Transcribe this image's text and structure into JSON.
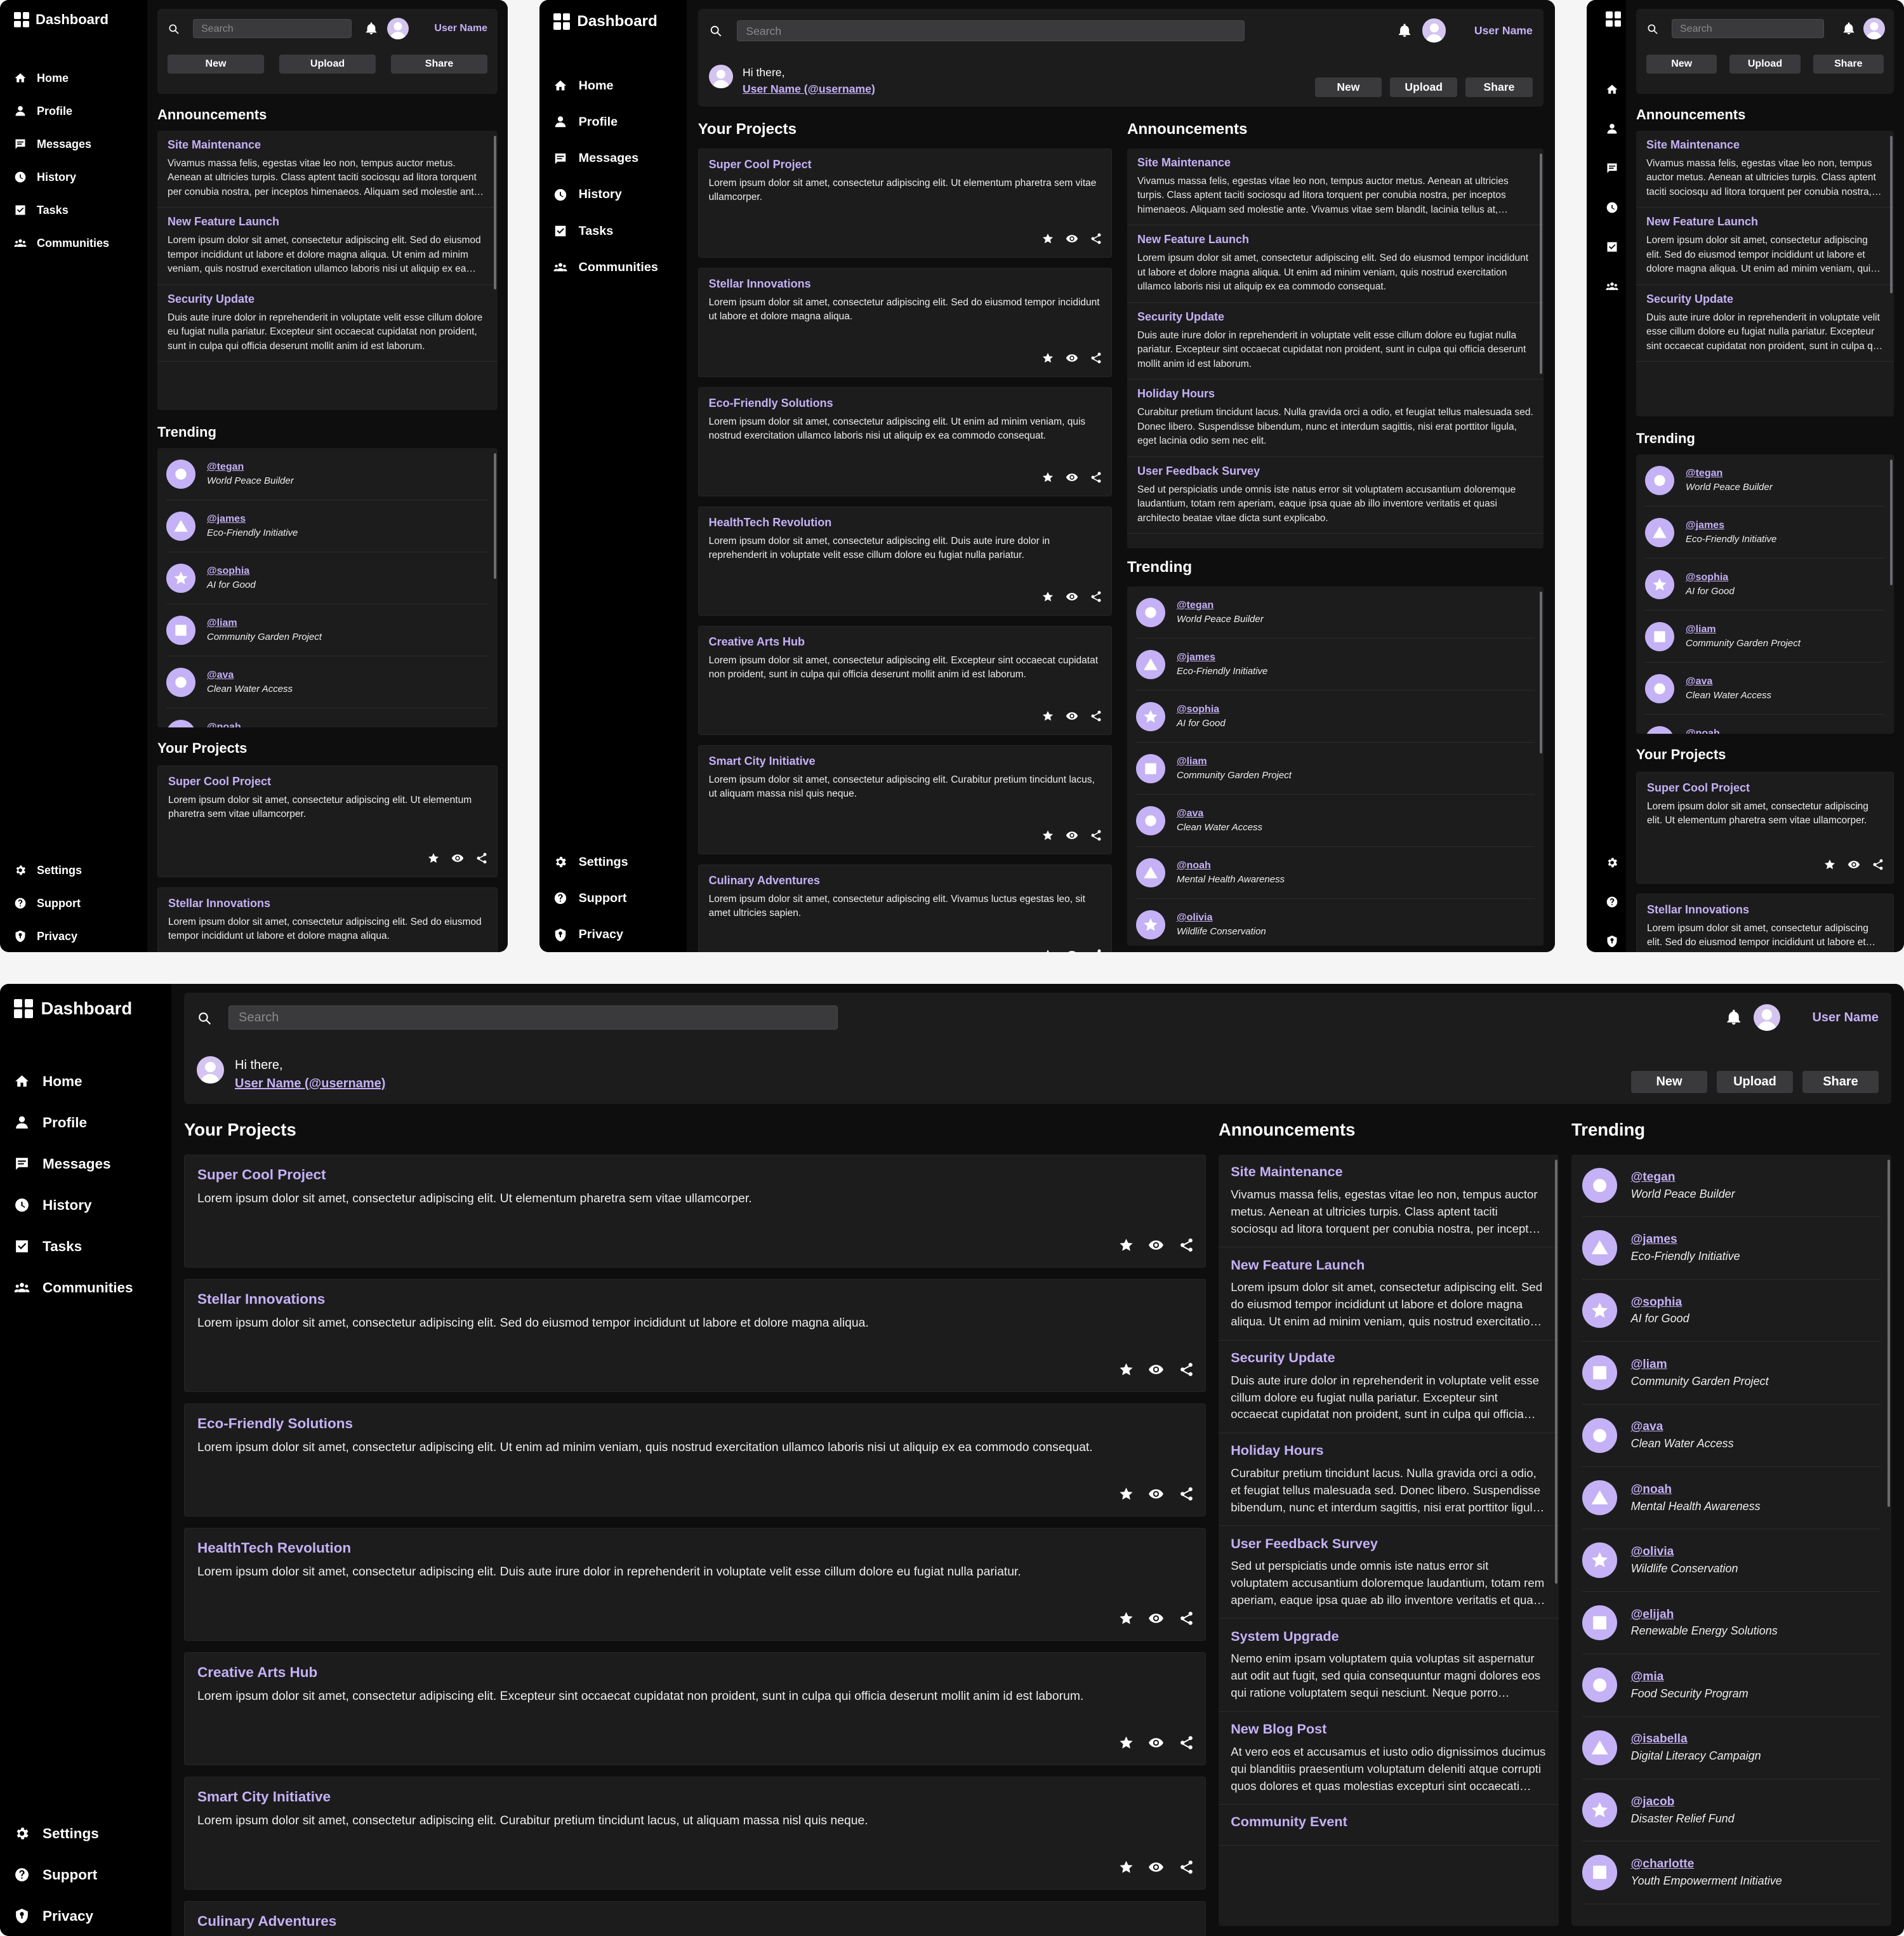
{
  "app": {
    "title": "Dashboard",
    "accent": "#c5b1f5",
    "background": "#000000",
    "surface": "#1c1c1d"
  },
  "nav": [
    {
      "label": "Home",
      "icon": "home-icon"
    },
    {
      "label": "Profile",
      "icon": "user-icon"
    },
    {
      "label": "Messages",
      "icon": "message-icon"
    },
    {
      "label": "History",
      "icon": "clock-icon"
    },
    {
      "label": "Tasks",
      "icon": "checkbox-icon"
    },
    {
      "label": "Communities",
      "icon": "people-icon"
    }
  ],
  "bottom_nav": [
    {
      "label": "Settings",
      "icon": "gear-icon"
    },
    {
      "label": "Support",
      "icon": "help-icon"
    },
    {
      "label": "Privacy",
      "icon": "privacy-icon"
    }
  ],
  "header": {
    "search_placeholder": "Search",
    "user_name": "User Name",
    "greeting": "Hi there,",
    "user_link": "User Name (@username)",
    "buttons": [
      "New",
      "Upload",
      "Share"
    ]
  },
  "sections": {
    "announcements": "Announcements",
    "trending": "Trending",
    "projects": "Your Projects"
  },
  "announcements": [
    {
      "title": "Site Maintenance",
      "body": "Vivamus massa felis, egestas vitae leo non, tempus auctor metus. Aenean at ultricies turpis. Class aptent taciti sociosqu ad litora torquent per conubia nostra, per inceptos himenaeos. Aliquam sed molestie ante. Vivamus vitae sem blandit, lacinia tellus at, pulvinar est."
    },
    {
      "title": "New Feature Launch",
      "body": "Lorem ipsum dolor sit amet, consectetur adipiscing elit. Sed do eiusmod tempor incididunt ut labore et dolore magna aliqua. Ut enim ad minim veniam, quis nostrud exercitation ullamco laboris nisi ut aliquip ex ea commodo consequat."
    },
    {
      "title": "Security Update",
      "body": "Duis aute irure dolor in reprehenderit in voluptate velit esse cillum dolore eu fugiat nulla pariatur. Excepteur sint occaecat cupidatat non proident, sunt in culpa qui officia deserunt mollit anim id est laborum."
    },
    {
      "title": "Holiday Hours",
      "body": "Curabitur pretium tincidunt lacus. Nulla gravida orci a odio, et feugiat tellus malesuada sed. Donec libero. Suspendisse bibendum, nunc et interdum sagittis, nisi erat porttitor ligula, eget lacinia odio sem nec elit."
    },
    {
      "title": "User Feedback Survey",
      "body": "Sed ut perspiciatis unde omnis iste natus error sit voluptatem accusantium doloremque laudantium, totam rem aperiam, eaque ipsa quae ab illo inventore veritatis et quasi architecto beatae vitae dicta sunt explicabo."
    },
    {
      "title": "System Upgrade",
      "body": "Nemo enim ipsam voluptatem quia voluptas sit aspernatur aut odit aut fugit, sed quia consequuntur magni dolores eos qui ratione voluptatem sequi nesciunt. Neque porro quisquam est."
    },
    {
      "title": "New Blog Post",
      "body": "At vero eos et accusamus et iusto odio dignissimos ducimus qui blanditiis praesentium voluptatum deleniti atque corrupti quos dolores et quas molestias excepturi sint occaecati cupiditate non provident."
    },
    {
      "title": "Community Event",
      "body": ""
    }
  ],
  "trending": [
    {
      "handle": "@tegan",
      "project": "World Peace Builder",
      "shape": "circle"
    },
    {
      "handle": "@james",
      "project": "Eco-Friendly Initiative",
      "shape": "triangle"
    },
    {
      "handle": "@sophia",
      "project": "AI for Good",
      "shape": "star"
    },
    {
      "handle": "@liam",
      "project": "Community Garden Project",
      "shape": "square"
    },
    {
      "handle": "@ava",
      "project": "Clean Water Access",
      "shape": "circle"
    },
    {
      "handle": "@noah",
      "project": "Mental Health Awareness",
      "shape": "triangle"
    },
    {
      "handle": "@olivia",
      "project": "Wildlife Conservation",
      "shape": "star"
    },
    {
      "handle": "@elijah",
      "project": "Renewable Energy Solutions",
      "shape": "square"
    },
    {
      "handle": "@mia",
      "project": "Food Security Program",
      "shape": "circle"
    },
    {
      "handle": "@isabella",
      "project": "Digital Literacy Campaign",
      "shape": "triangle"
    },
    {
      "handle": "@jacob",
      "project": "Disaster Relief Fund",
      "shape": "star"
    },
    {
      "handle": "@charlotte",
      "project": "Youth Empowerment Initiative",
      "shape": "square"
    }
  ],
  "projects": [
    {
      "title": "Super Cool Project",
      "body": "Lorem ipsum dolor sit amet, consectetur adipiscing elit. Ut elementum pharetra sem vitae ullamcorper."
    },
    {
      "title": "Stellar Innovations",
      "body": "Lorem ipsum dolor sit amet, consectetur adipiscing elit. Sed do eiusmod tempor incididunt ut labore et dolore magna aliqua."
    },
    {
      "title": "Eco-Friendly Solutions",
      "body": "Lorem ipsum dolor sit amet, consectetur adipiscing elit. Ut enim ad minim veniam, quis nostrud exercitation ullamco laboris nisi ut aliquip ex ea commodo consequat."
    },
    {
      "title": "HealthTech Revolution",
      "body": "Lorem ipsum dolor sit amet, consectetur adipiscing elit. Duis aute irure dolor in reprehenderit in voluptate velit esse cillum dolore eu fugiat nulla pariatur."
    },
    {
      "title": "Creative Arts Hub",
      "body": "Lorem ipsum dolor sit amet, consectetur adipiscing elit. Excepteur sint occaecat cupidatat non proident, sunt in culpa qui officia deserunt mollit anim id est laborum."
    },
    {
      "title": "Smart City Initiative",
      "body": "Lorem ipsum dolor sit amet, consectetur adipiscing elit. Curabitur pretium tincidunt lacus, ut aliquam massa nisl quis neque."
    },
    {
      "title": "Culinary Adventures",
      "body": "Lorem ipsum dolor sit amet, consectetur adipiscing elit. Vivamus luctus egestas leo, sit amet ultricies sapien."
    }
  ]
}
